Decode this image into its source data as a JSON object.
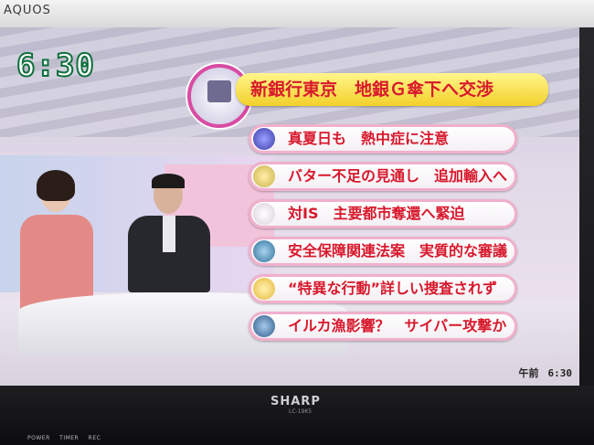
{
  "tv": {
    "brand_top": "AQUOS",
    "brand_bottom": "SHARP",
    "model": "LC-19K5",
    "indicators": [
      "POWER",
      "TIMER",
      "REC"
    ]
  },
  "broadcast": {
    "clock": "6:30",
    "time_tag_prefix": "午前",
    "time_tag_value": "6:30",
    "headlines": [
      {
        "text": "新銀行東京　地銀Ｇ傘下へ交渉",
        "icon": "bank-logo-icon"
      },
      {
        "text": "真夏日も　熱中症に注意",
        "icon": "heat-icon",
        "icon_color": "#5a5ad0"
      },
      {
        "text": "バター不足の見通し　追加輸入へ",
        "icon": "butter-icon",
        "icon_color": "#d8c46a"
      },
      {
        "text": "対IS　主要都市奪還へ緊迫",
        "icon": "dot-icon",
        "icon_color": "#e9e3e9"
      },
      {
        "text": "安全保障関連法案　実質的な審議",
        "icon": "diet-building-icon",
        "icon_color": "#3f7fa8"
      },
      {
        "text": "“特異な行動”詳しい捜査されず",
        "icon": "dot-icon",
        "icon_color": "#f0c94a"
      },
      {
        "text": "イルカ漁影響？　サイバー攻撃か",
        "icon": "dolphin-icon",
        "icon_color": "#3b6fa0"
      }
    ]
  }
}
